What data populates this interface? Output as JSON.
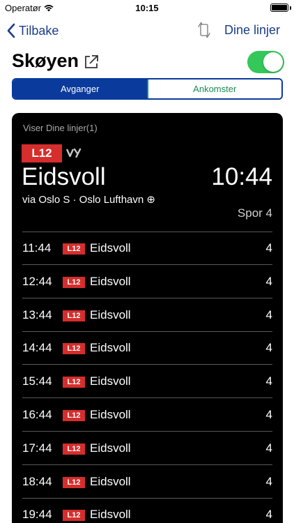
{
  "status_bar": {
    "carrier": "Operatør",
    "time": "10:15",
    "battery_level": 1.0
  },
  "nav": {
    "back_label": "Tilbake",
    "right_label": "Dine linjer"
  },
  "header": {
    "station": "Skøyen",
    "toggle_on": true
  },
  "segments": [
    {
      "label": "Avganger",
      "active": true
    },
    {
      "label": "Ankomster",
      "active": false
    }
  ],
  "board": {
    "subtitle": "Viser Dine linjer(1)",
    "next": {
      "line": "L12",
      "operator": "vy",
      "destination": "Eidsvoll",
      "time": "10:44",
      "via": "via Oslo S · Oslo Lufthavn ⊕",
      "track": "Spor 4"
    },
    "rows": [
      {
        "time": "11:44",
        "line": "L12",
        "destination": "Eidsvoll",
        "track": "4"
      },
      {
        "time": "12:44",
        "line": "L12",
        "destination": "Eidsvoll",
        "track": "4"
      },
      {
        "time": "13:44",
        "line": "L12",
        "destination": "Eidsvoll",
        "track": "4"
      },
      {
        "time": "14:44",
        "line": "L12",
        "destination": "Eidsvoll",
        "track": "4"
      },
      {
        "time": "15:44",
        "line": "L12",
        "destination": "Eidsvoll",
        "track": "4"
      },
      {
        "time": "16:44",
        "line": "L12",
        "destination": "Eidsvoll",
        "track": "4"
      },
      {
        "time": "17:44",
        "line": "L12",
        "destination": "Eidsvoll",
        "track": "4"
      },
      {
        "time": "18:44",
        "line": "L12",
        "destination": "Eidsvoll",
        "track": "4"
      },
      {
        "time": "19:44",
        "line": "L12",
        "destination": "Eidsvoll",
        "track": "4"
      }
    ]
  },
  "colors": {
    "nav_blue": "#1a3c8a",
    "segment_blue": "#0a3a9c",
    "segment_green": "#1a8a52",
    "toggle_green": "#34c759",
    "line_red": "#d62d2d",
    "board_bg": "#000000"
  }
}
